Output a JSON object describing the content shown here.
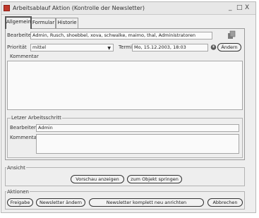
{
  "window": {
    "title": "Arbeitsablauf Aktion (Kontrolle der Newsletter)",
    "controls": {
      "minimize": "_",
      "maximize": "□",
      "close": "X"
    }
  },
  "tabs": [
    {
      "label": "Allgemein"
    },
    {
      "label": "Formular"
    },
    {
      "label": "Historie"
    }
  ],
  "general": {
    "bearbeiter_label": "Bearbeiter",
    "bearbeiter_value": "Admin, Rusch, shoebbel, xova, schwalke, maimo, thal, Administratoren",
    "prioritaet_label": "Priorität",
    "prioritaet_value": "mittel",
    "termin_label": "Termin",
    "termin_value": "Mo, 15.12.2003, 18:03",
    "aendern_label": "Ändern",
    "kommentar_label": "Kommentar"
  },
  "letzter": {
    "title": "Letzer Arbeitsschritt",
    "bearbeiter_label": "Bearbeiter",
    "bearbeiter_value": "Admin",
    "kommentar_label": "Kommentar"
  },
  "ansicht": {
    "title": "Ansicht",
    "vorschau_label": "Vorschau anzeigen",
    "springen_label": "zum Objekt springen"
  },
  "aktionen": {
    "title": "Aktionen",
    "freigabe_label": "Freigabe",
    "aendern_label": "Newsletter ändern",
    "neu_label": "Newsletter komplett neu anrichten",
    "abbrechen_label": "Abbrechen"
  }
}
